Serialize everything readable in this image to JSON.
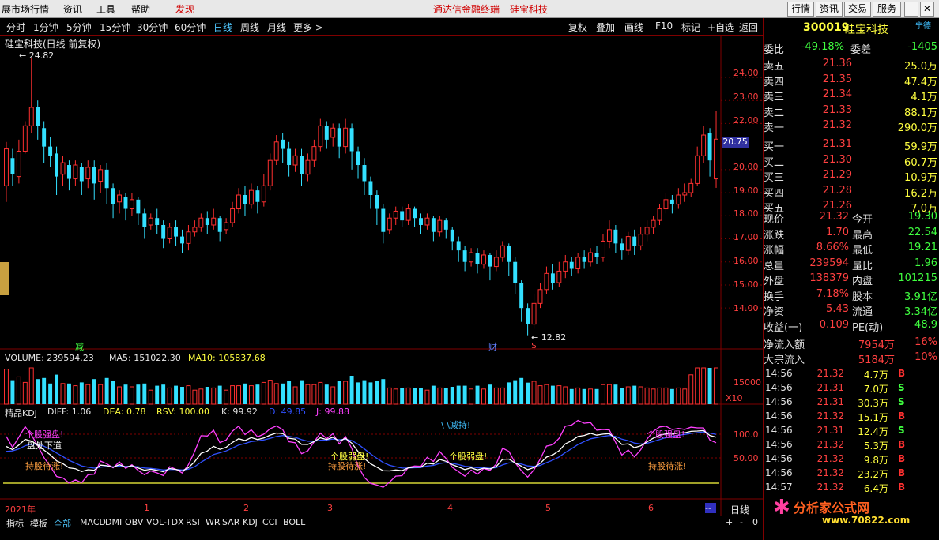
{
  "menu": {
    "items": [
      "展市场行情",
      "资讯",
      "工具",
      "帮助"
    ],
    "discover": "发现",
    "center_brand": "通达信金融终端",
    "center_stock": "硅宝科技",
    "right_buttons": [
      "行情",
      "资讯",
      "交易",
      "服务"
    ]
  },
  "toolbar": {
    "periods": [
      "分时",
      "1分钟",
      "5分钟",
      "15分钟",
      "30分钟",
      "60分钟",
      "日线",
      "周线",
      "月线",
      "更多 >"
    ],
    "active_period": "日线",
    "right": [
      "复权",
      "叠加",
      "画线",
      "F10",
      "标记",
      "+自选",
      "返回"
    ]
  },
  "chart_title": "硅宝科技(日线 前复权)",
  "code_header": {
    "code": "300019",
    "name": "硅宝科技",
    "extra": "宁德"
  },
  "price_axis": {
    "labels": [
      "24.00",
      "23.00",
      "22.00",
      "20.00",
      "19.00",
      "18.00",
      "17.00",
      "16.00",
      "15.00",
      "14.00"
    ],
    "current": "20.75"
  },
  "annotations": {
    "high": "24.82",
    "low": "12.82",
    "mark1": "减",
    "mark2": "财",
    "mark3": "$"
  },
  "volume": {
    "title": "VOLUME: 239594.23",
    "ma5": "MA5: 151022.30",
    "ma10": "MA10: 105837.68",
    "axis": "15000",
    "unit": "X10"
  },
  "kdj": {
    "title": "精品KDJ",
    "diff": "DIFF: 1.06",
    "dea": "DEA: 0.78",
    "rsv": "RSV: 100.00",
    "k": "K: 99.92",
    "d": "D: 49.85",
    "j": "J: 99.88",
    "axis": [
      "100.0",
      "50.00"
    ],
    "notes": {
      "n1": "个股强盘!",
      "n2": "盘处下道",
      "n3": "持股待涨!",
      "n4": "个股弱盘!",
      "n5": "持股待涨!",
      "n6": "个股弱盘!",
      "n7": "\\ \\减持!",
      "n8": "个股强盘!",
      "n9": "持股待涨!"
    }
  },
  "date_axis": {
    "year": "2021年",
    "months": [
      "1",
      "2",
      "3",
      "4",
      "5",
      "6"
    ],
    "period": "日线"
  },
  "bottom_tabs": [
    "指标",
    "模板",
    "全部",
    "MACD",
    "DMI",
    "OBV",
    "VOL-TDX",
    "RSI",
    "WR",
    "SAR",
    "KDJ",
    "CCI",
    "BOLL"
  ],
  "bottom_active": "全部",
  "weibi": {
    "l1": "委比",
    "v1": "-49.18%",
    "l2": "委差",
    "v2": "-1405"
  },
  "order_book": [
    {
      "label": "卖五",
      "price": "21.36",
      "vol": "25.0万"
    },
    {
      "label": "卖四",
      "price": "21.35",
      "vol": "47.4万"
    },
    {
      "label": "卖三",
      "price": "21.34",
      "vol": "4.1万"
    },
    {
      "label": "卖二",
      "price": "21.33",
      "vol": "88.1万"
    },
    {
      "label": "卖一",
      "price": "21.32",
      "vol": "290.0万"
    },
    {
      "label": "买一",
      "price": "21.31",
      "vol": "59.9万"
    },
    {
      "label": "买二",
      "price": "21.30",
      "vol": "60.7万"
    },
    {
      "label": "买三",
      "price": "21.29",
      "vol": "10.9万"
    },
    {
      "label": "买四",
      "price": "21.28",
      "vol": "16.2万"
    },
    {
      "label": "买五",
      "price": "21.26",
      "vol": "7.0万"
    }
  ],
  "stats": [
    {
      "l1": "现价",
      "v1": "21.32",
      "l2": "今开",
      "v2": "19.30"
    },
    {
      "l1": "涨跌",
      "v1": "1.70",
      "l2": "最高",
      "v2": "22.54"
    },
    {
      "l1": "涨幅",
      "v1": "8.66%",
      "l2": "最低",
      "v2": "19.21"
    },
    {
      "l1": "总量",
      "v1": "239594",
      "l2": "量比",
      "v2": "1.96"
    },
    {
      "l1": "外盘",
      "v1": "138379",
      "l2": "内盘",
      "v2": "101215"
    },
    {
      "l1": "换手",
      "v1": "7.18%",
      "l2": "股本",
      "v2": "3.91亿"
    },
    {
      "l1": "净资",
      "v1": "5.43",
      "l2": "流通",
      "v2": "3.34亿"
    },
    {
      "l1": "收益(一)",
      "v1": "0.109",
      "l2": "PE(动)",
      "v2": "48.9"
    }
  ],
  "flow": [
    {
      "label": "净流入额",
      "val": "7954万",
      "pct": "16%"
    },
    {
      "label": "大宗流入",
      "val": "5184万",
      "pct": "10%"
    }
  ],
  "ticks": [
    {
      "time": "14:56",
      "price": "21.32",
      "vol": "4.7万",
      "bs": "B"
    },
    {
      "time": "14:56",
      "price": "21.31",
      "vol": "7.0万",
      "bs": "S"
    },
    {
      "time": "14:56",
      "price": "21.31",
      "vol": "30.3万",
      "bs": "S"
    },
    {
      "time": "14:56",
      "price": "21.32",
      "vol": "15.1万",
      "bs": "B"
    },
    {
      "time": "14:56",
      "price": "21.31",
      "vol": "12.4万",
      "bs": "S"
    },
    {
      "time": "14:56",
      "price": "21.32",
      "vol": "5.3万",
      "bs": "B"
    },
    {
      "time": "14:56",
      "price": "21.32",
      "vol": "9.8万",
      "bs": "B"
    },
    {
      "time": "14:56",
      "price": "21.32",
      "vol": "23.2万",
      "bs": "B"
    },
    {
      "time": "14:57",
      "price": "21.32",
      "vol": "6.4万",
      "bs": "B"
    }
  ],
  "watermark": {
    "brand": "分析家公式网",
    "url": "www.70822.com"
  },
  "colors": {
    "up": "#ff3030",
    "down": "#33e0ff",
    "yellow": "#ffff40",
    "magenta": "#ff40ff",
    "blue": "#3050ff",
    "frame": "#800000"
  },
  "candles": [
    [
      19.3,
      20.9,
      18.6,
      21.2
    ],
    [
      20.5,
      19.8,
      19.3,
      20.9
    ],
    [
      19.7,
      20.8,
      19.4,
      21.3
    ],
    [
      20.8,
      21.9,
      20.7,
      22.1
    ],
    [
      21.9,
      22.7,
      21.6,
      24.82
    ],
    [
      22.7,
      21.9,
      21.3,
      23.0
    ],
    [
      21.8,
      21.0,
      20.3,
      22.1
    ],
    [
      21.0,
      20.6,
      20.1,
      21.4
    ],
    [
      20.7,
      19.7,
      18.9,
      21.0
    ],
    [
      19.8,
      20.3,
      19.3,
      20.6
    ],
    [
      20.2,
      19.6,
      19.1,
      20.4
    ],
    [
      19.6,
      20.2,
      19.3,
      20.4
    ],
    [
      20.1,
      19.5,
      18.9,
      20.3
    ],
    [
      19.6,
      20.1,
      19.2,
      20.4
    ],
    [
      20.1,
      19.4,
      18.7,
      20.4
    ],
    [
      19.5,
      20.0,
      19.0,
      20.2
    ],
    [
      20.0,
      19.2,
      18.5,
      20.3
    ],
    [
      19.2,
      18.5,
      17.9,
      19.4
    ],
    [
      18.6,
      18.9,
      18.1,
      19.1
    ],
    [
      18.8,
      18.3,
      17.8,
      19.0
    ],
    [
      18.3,
      18.7,
      18.0,
      19.0
    ],
    [
      18.7,
      18.1,
      17.6,
      18.8
    ],
    [
      18.1,
      17.5,
      17.0,
      18.3
    ],
    [
      17.6,
      17.9,
      17.4,
      18.1
    ],
    [
      17.9,
      17.6,
      17.2,
      18.3
    ],
    [
      17.6,
      17.0,
      16.6,
      17.8
    ],
    [
      17.0,
      17.5,
      16.8,
      17.7
    ],
    [
      17.5,
      17.1,
      16.7,
      17.8
    ],
    [
      17.1,
      16.8,
      16.4,
      17.4
    ],
    [
      16.8,
      17.3,
      16.5,
      17.6
    ],
    [
      17.3,
      17.5,
      17.1,
      17.8
    ],
    [
      17.5,
      17.9,
      17.3,
      18.1
    ],
    [
      17.9,
      17.6,
      17.2,
      18.2
    ],
    [
      17.6,
      17.9,
      17.4,
      18.3
    ],
    [
      17.9,
      17.3,
      16.9,
      18.0
    ],
    [
      17.4,
      17.7,
      17.2,
      17.9
    ],
    [
      17.7,
      18.3,
      17.5,
      18.6
    ],
    [
      18.3,
      18.9,
      18.1,
      19.2
    ],
    [
      18.9,
      18.5,
      18.0,
      19.3
    ],
    [
      18.5,
      19.1,
      18.3,
      19.4
    ],
    [
      19.1,
      18.6,
      18.1,
      19.3
    ],
    [
      18.6,
      19.3,
      18.4,
      19.8
    ],
    [
      19.3,
      20.4,
      19.1,
      20.7
    ],
    [
      20.4,
      21.2,
      20.2,
      21.5
    ],
    [
      21.3,
      20.9,
      20.3,
      21.6
    ],
    [
      20.9,
      20.2,
      19.7,
      21.2
    ],
    [
      20.2,
      20.6,
      19.9,
      20.9
    ],
    [
      20.6,
      19.8,
      19.3,
      20.9
    ],
    [
      19.8,
      20.4,
      19.5,
      20.7
    ],
    [
      20.4,
      21.0,
      20.1,
      21.3
    ],
    [
      21.0,
      21.9,
      20.8,
      22.2
    ],
    [
      21.9,
      21.3,
      20.9,
      22.1
    ],
    [
      21.4,
      21.8,
      21.0,
      22.0
    ],
    [
      21.8,
      21.0,
      20.5,
      22.0
    ],
    [
      21.0,
      21.8,
      20.7,
      22.2
    ],
    [
      21.8,
      20.8,
      20.0,
      22.0
    ],
    [
      20.8,
      20.2,
      19.6,
      21.0
    ],
    [
      20.2,
      19.5,
      18.9,
      20.5
    ],
    [
      19.5,
      18.9,
      18.3,
      19.7
    ],
    [
      18.9,
      18.3,
      17.6,
      19.1
    ],
    [
      18.3,
      17.3,
      16.8,
      18.5
    ],
    [
      17.4,
      17.9,
      17.2,
      18.1
    ],
    [
      17.9,
      18.2,
      17.6,
      18.4
    ],
    [
      18.2,
      17.8,
      17.5,
      18.4
    ],
    [
      17.8,
      18.3,
      17.6,
      18.5
    ],
    [
      18.3,
      17.9,
      17.5,
      18.4
    ],
    [
      17.9,
      17.6,
      17.2,
      18.1
    ],
    [
      17.6,
      17.9,
      17.4,
      18.1
    ],
    [
      17.9,
      17.3,
      16.9,
      18.0
    ],
    [
      17.3,
      17.8,
      17.1,
      18.0
    ],
    [
      17.8,
      17.4,
      17.0,
      17.9
    ],
    [
      17.4,
      16.9,
      16.5,
      17.5
    ],
    [
      16.9,
      16.5,
      16.0,
      17.1
    ],
    [
      16.5,
      16.0,
      15.6,
      16.7
    ],
    [
      16.0,
      16.4,
      15.8,
      16.6
    ],
    [
      16.4,
      15.9,
      15.5,
      16.6
    ],
    [
      15.9,
      16.3,
      15.7,
      16.5
    ],
    [
      16.3,
      15.8,
      15.2,
      16.4
    ],
    [
      15.8,
      16.2,
      15.6,
      16.5
    ],
    [
      16.2,
      16.7,
      16.0,
      16.9
    ],
    [
      16.7,
      16.0,
      15.4,
      16.8
    ],
    [
      16.0,
      15.1,
      14.6,
      16.2
    ],
    [
      15.1,
      14.0,
      13.4,
      15.2
    ],
    [
      14.0,
      13.3,
      12.82,
      14.2
    ],
    [
      13.3,
      14.2,
      13.1,
      14.6
    ],
    [
      14.2,
      14.8,
      14.0,
      15.1
    ],
    [
      14.8,
      15.5,
      14.6,
      15.8
    ],
    [
      15.5,
      15.1,
      14.8,
      15.9
    ],
    [
      15.1,
      15.6,
      14.9,
      16.0
    ],
    [
      15.6,
      16.0,
      15.3,
      16.3
    ],
    [
      16.0,
      15.7,
      15.4,
      16.2
    ],
    [
      15.7,
      16.2,
      15.5,
      16.4
    ],
    [
      16.2,
      16.0,
      15.7,
      16.5
    ],
    [
      16.0,
      16.4,
      15.8,
      16.6
    ],
    [
      16.4,
      16.2,
      15.9,
      16.7
    ],
    [
      16.2,
      16.9,
      16.0,
      17.2
    ],
    [
      16.9,
      17.4,
      16.6,
      17.8
    ],
    [
      17.4,
      16.8,
      16.4,
      17.6
    ],
    [
      16.8,
      16.5,
      16.1,
      17.0
    ],
    [
      16.5,
      17.1,
      16.3,
      17.3
    ],
    [
      17.1,
      16.7,
      16.3,
      17.4
    ],
    [
      16.7,
      17.2,
      16.5,
      17.5
    ],
    [
      17.2,
      17.5,
      16.9,
      17.8
    ],
    [
      17.5,
      17.8,
      17.2,
      18.0
    ],
    [
      17.8,
      18.3,
      17.6,
      18.5
    ],
    [
      18.3,
      18.7,
      18.1,
      19.0
    ],
    [
      18.7,
      18.5,
      18.1,
      18.9
    ],
    [
      18.5,
      18.9,
      18.3,
      19.2
    ],
    [
      18.9,
      19.0,
      18.6,
      19.4
    ],
    [
      19.0,
      19.4,
      18.8,
      19.6
    ],
    [
      19.4,
      20.6,
      19.3,
      21.0
    ],
    [
      20.6,
      21.5,
      20.3,
      21.9
    ],
    [
      21.6,
      20.4,
      19.7,
      21.8
    ],
    [
      19.6,
      21.32,
      19.21,
      22.54
    ]
  ],
  "price_range": [
    12.5,
    25.3
  ]
}
